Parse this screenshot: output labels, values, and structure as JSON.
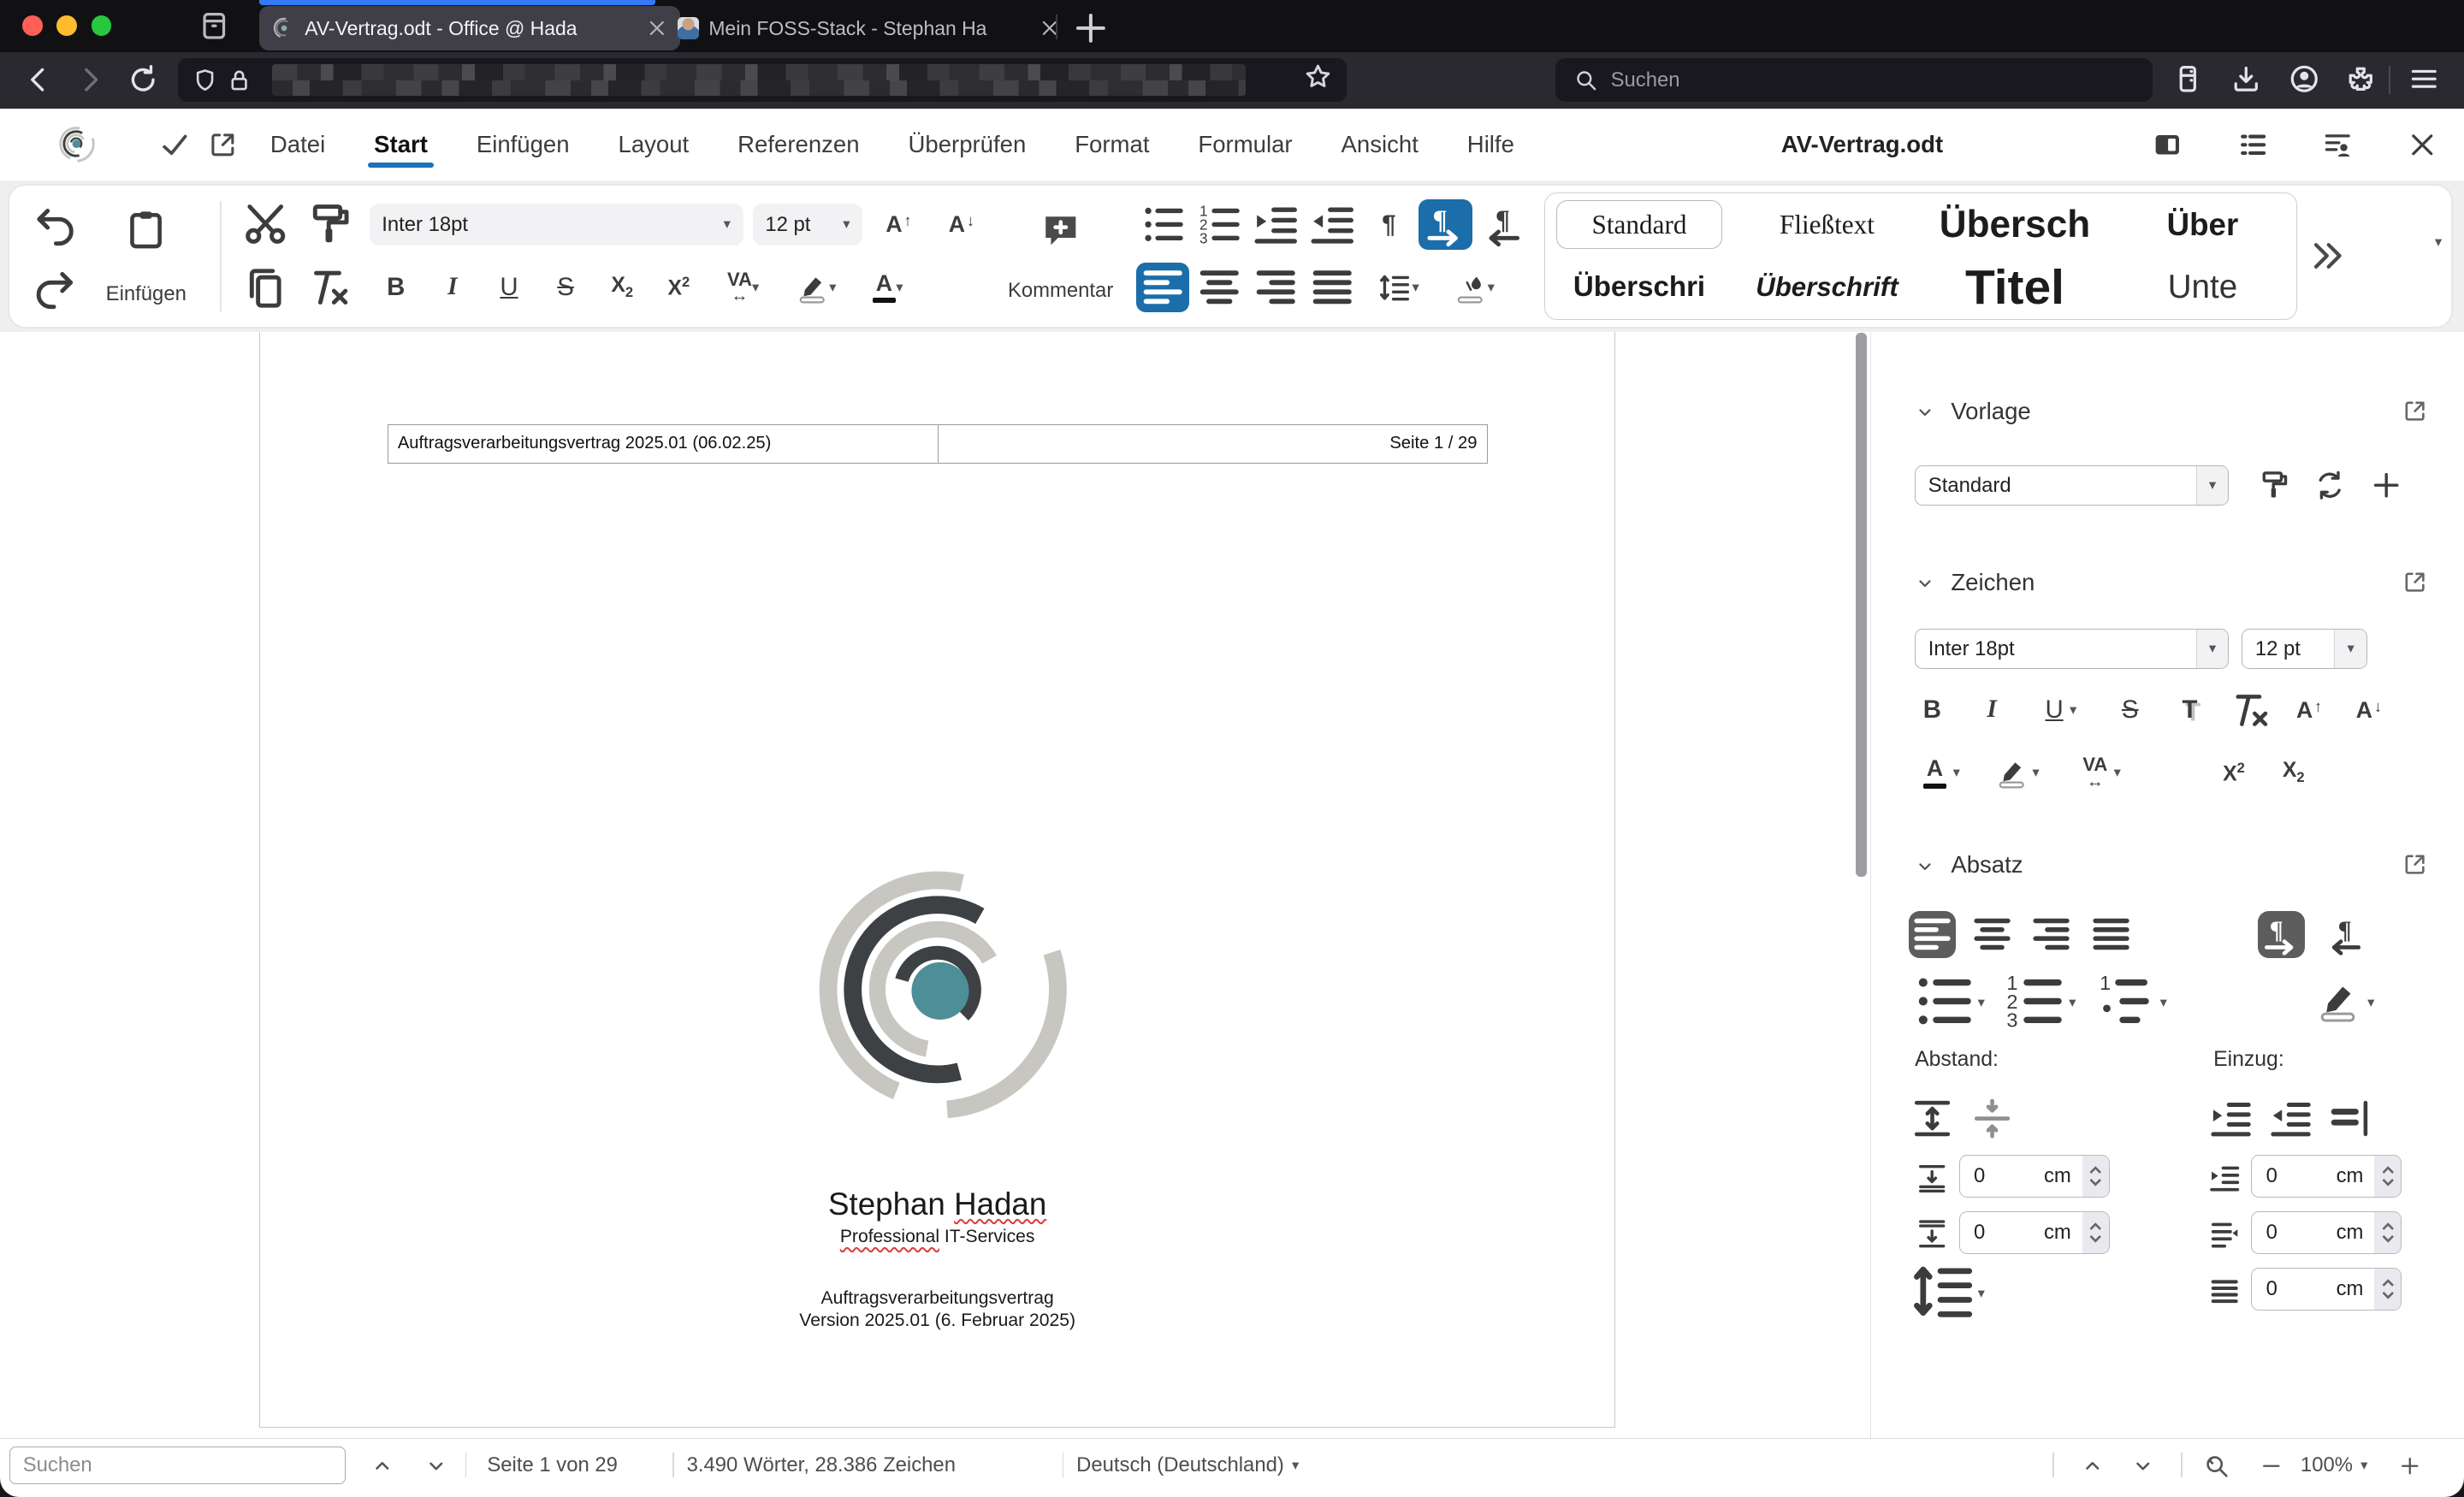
{
  "browser": {
    "tabs": [
      {
        "title": "AV-Vertrag.odt - Office @ Hada"
      },
      {
        "title": "Mein FOSS-Stack - Stephan Ha"
      }
    ],
    "search_placeholder": "Suchen"
  },
  "menubar": {
    "items": [
      "Datei",
      "Start",
      "Einfügen",
      "Layout",
      "Referenzen",
      "Überprüfen",
      "Format",
      "Formular",
      "Ansicht",
      "Hilfe"
    ],
    "active_item": "Start",
    "document_title": "AV-Vertrag.odt"
  },
  "toolbar": {
    "paste_label": "Einfügen",
    "comment_label": "Kommentar",
    "font_name": "Inter 18pt",
    "font_size": "12 pt",
    "styles": [
      "Standard",
      "Fließtext",
      "Übersch",
      "Über",
      "Überschri",
      "Überschrift",
      "Titel",
      "Unte"
    ]
  },
  "document": {
    "header_left": "Auftragsverarbeitungsvertrag 2025.01 (06.02.25)",
    "header_right": "Seite 1 / 29",
    "name_first": "Stephan",
    "name_last": "Hadan",
    "subtitle_word": "Professional",
    "subtitle_rest": "IT-Services",
    "line1": "Auftragsverarbeitungsvertrag",
    "line2": "Version 2025.01 (6. Februar 2025)"
  },
  "sidebar": {
    "vorlage_label": "Vorlage",
    "zeichen_label": "Zeichen",
    "absatz_label": "Absatz",
    "style_value": "Standard",
    "font_name": "Inter 18pt",
    "font_size": "12 pt",
    "abstand_label": "Abstand:",
    "einzug_label": "Einzug:",
    "spin_value": "0",
    "spin_unit": "cm"
  },
  "statusbar": {
    "search_placeholder": "Suchen",
    "page": "Seite 1 von 29",
    "words": "3.490 Wörter, 28.386 Zeichen",
    "language": "Deutsch (Deutschland)",
    "zoom": "100%"
  },
  "colors": {
    "accent_blue": "#1b6ea9",
    "start_underline": "#1b72bd",
    "tab_accent": "#3579f6",
    "sidebar_active": "#5d5d5d",
    "squiggle_red": "#dd3b3b",
    "logo_dark": "#3e4144",
    "logo_light": "#c8c6c0",
    "logo_teal": "#4e8e98",
    "traffic_red": "#ff5f57",
    "traffic_yellow": "#febc2e",
    "traffic_green": "#29c740"
  }
}
